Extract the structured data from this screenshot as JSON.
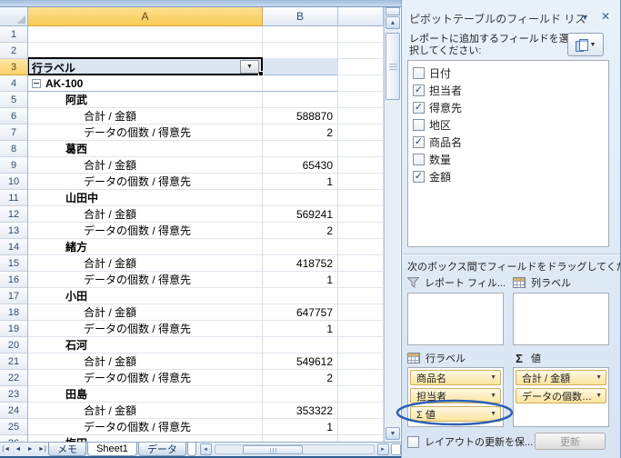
{
  "icons": {
    "pane_dropdown": "▼",
    "close": "✕",
    "cell_dropdown": "▼",
    "sigma": "Σ",
    "check": "✓",
    "nav": [
      "|◄",
      "◄",
      "►",
      "►|"
    ],
    "tab_scroll_left": "◄",
    "tab_scroll_right": "►",
    "scroll_up": "▲",
    "scroll_down": "▼",
    "collapse": "−"
  },
  "grid": {
    "columns": [
      {
        "label": "A"
      },
      {
        "label": "B"
      },
      {
        "label": ""
      }
    ],
    "row_count": 26,
    "selected_row": 3,
    "pivot": {
      "header": "行ラベル",
      "rows": [
        {
          "label": "AK-100",
          "level": 0,
          "bold": true,
          "collapse": true,
          "split": true
        },
        {
          "label": "阿武",
          "level": 1,
          "bold": true
        },
        {
          "label": "合計 / 金額",
          "level": 2,
          "value": "588870"
        },
        {
          "label": "データの個数 / 得意先",
          "level": 2,
          "value": "2"
        },
        {
          "label": "葛西",
          "level": 1,
          "bold": true
        },
        {
          "label": "合計 / 金額",
          "level": 2,
          "value": "65430"
        },
        {
          "label": "データの個数 / 得意先",
          "level": 2,
          "value": "1"
        },
        {
          "label": "山田中",
          "level": 1,
          "bold": true
        },
        {
          "label": "合計 / 金額",
          "level": 2,
          "value": "569241"
        },
        {
          "label": "データの個数 / 得意先",
          "level": 2,
          "value": "2"
        },
        {
          "label": "緒方",
          "level": 1,
          "bold": true
        },
        {
          "label": "合計 / 金額",
          "level": 2,
          "value": "418752"
        },
        {
          "label": "データの個数 / 得意先",
          "level": 2,
          "value": "1"
        },
        {
          "label": "小田",
          "level": 1,
          "bold": true
        },
        {
          "label": "合計 / 金額",
          "level": 2,
          "value": "647757"
        },
        {
          "label": "データの個数 / 得意先",
          "level": 2,
          "value": "1"
        },
        {
          "label": "石河",
          "level": 1,
          "bold": true
        },
        {
          "label": "合計 / 金額",
          "level": 2,
          "value": "549612"
        },
        {
          "label": "データの個数 / 得意先",
          "level": 2,
          "value": "2"
        },
        {
          "label": "田島",
          "level": 1,
          "bold": true
        },
        {
          "label": "合計 / 金額",
          "level": 2,
          "value": "353322"
        },
        {
          "label": "データの個数 / 得意先",
          "level": 2,
          "value": "1"
        },
        {
          "label": "梅田",
          "level": 1,
          "bold": true
        }
      ]
    }
  },
  "tabs": {
    "items": [
      {
        "label": "メモ",
        "active": false
      },
      {
        "label": "Sheet1",
        "active": true
      },
      {
        "label": "データ",
        "active": false
      }
    ]
  },
  "panel": {
    "title": "ピボットテーブルのフィールド リス",
    "instruction": "レポートに追加するフィールドを選択してください:",
    "fields": [
      {
        "label": "日付",
        "checked": false
      },
      {
        "label": "担当者",
        "checked": true
      },
      {
        "label": "得意先",
        "checked": true
      },
      {
        "label": "地区",
        "checked": false
      },
      {
        "label": "商品名",
        "checked": true
      },
      {
        "label": "数量",
        "checked": false
      },
      {
        "label": "金額",
        "checked": true
      }
    ],
    "drag_instruction": "次のボックス間でフィールドをドラッグしてください:",
    "areas": {
      "report_filter": {
        "title": "レポート フィル...",
        "items": []
      },
      "column_labels": {
        "title": "列ラベル",
        "items": []
      },
      "row_labels": {
        "title": "行ラベル",
        "items": [
          "商品名",
          "担当者",
          "Σ 値"
        ]
      },
      "values": {
        "title": "値",
        "items": [
          "合計 / 金額",
          "データの個数 ..."
        ]
      }
    },
    "annotation_color": "#2B5FB5",
    "defer_label": "レイアウトの更新を保...",
    "update_label": "更新"
  }
}
